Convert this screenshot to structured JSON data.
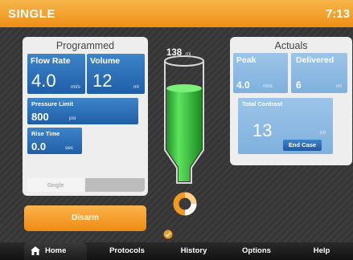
{
  "title": {
    "mode": "SINGLE",
    "clock": "7:13"
  },
  "programmed": {
    "title": "Programmed",
    "flow_rate": {
      "label": "Flow Rate",
      "value": "4.0",
      "unit": "ml/s"
    },
    "volume": {
      "label": "Volume",
      "value": "12",
      "unit": "ml"
    },
    "pressure_limit": {
      "label": "Pressure Limit",
      "value": "800",
      "unit": "psi"
    },
    "rise_time": {
      "label": "Rise Time",
      "value": "0.0",
      "unit": "sec"
    },
    "tab_single": "Single"
  },
  "syringe": {
    "volume": "138",
    "unit": "ml",
    "fill_fraction": 0.65
  },
  "actuals": {
    "title": "Actuals",
    "peak": {
      "label": "Peak",
      "value": "4.0",
      "unit": "ml/s"
    },
    "delivered": {
      "label": "Delivered",
      "value": "6",
      "unit": "ml"
    },
    "total_contrast": {
      "label": "Total Contrast",
      "value": "13",
      "unit": "ml"
    },
    "end_case": "End Case"
  },
  "disarm_label": "Disarm",
  "nav": {
    "home": "Home",
    "protocols": "Protocols",
    "history": "History",
    "options": "Options",
    "help": "Help"
  },
  "colors": {
    "accent": "#f29a1f",
    "primary_blue": "#2a6db8",
    "fluid_green": "#35c23a"
  },
  "icons": {
    "home": "home-icon",
    "status": "check-icon",
    "progress": "progress-ring-icon"
  }
}
